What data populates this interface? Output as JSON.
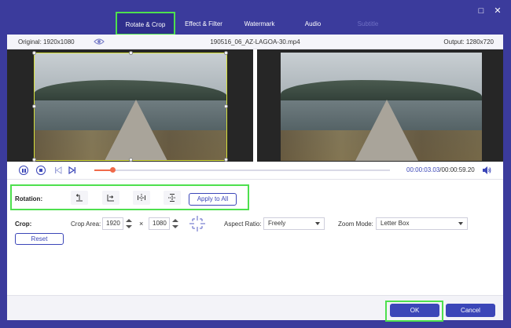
{
  "window": {
    "minimize_icon": "□",
    "close_icon": "✕"
  },
  "tabs": [
    {
      "label": "Rotate & Crop",
      "state": "active"
    },
    {
      "label": "Effect & Filter",
      "state": "normal"
    },
    {
      "label": "Watermark",
      "state": "normal"
    },
    {
      "label": "Audio",
      "state": "normal"
    },
    {
      "label": "Subtitle",
      "state": "disabled"
    }
  ],
  "info": {
    "original": "Original: 1920x1080",
    "filename": "190516_06_AZ-LAGOA-30.mp4",
    "output": "Output: 1280x720"
  },
  "playback": {
    "current_time": "00:00:03.03",
    "total_time": "/00:00:59.20",
    "progress": 0.06
  },
  "rotation": {
    "label": "Rotation:",
    "buttons": [
      "rotate-left-icon",
      "rotate-right-icon",
      "flip-horizontal-icon",
      "flip-vertical-icon"
    ],
    "apply_label": "Apply to All"
  },
  "crop": {
    "label": "Crop:",
    "area_label": "Crop Area:",
    "width": "1920",
    "times": "×",
    "height": "1080",
    "aspect_label": "Aspect Ratio:",
    "aspect_value": "Freely",
    "zoom_label": "Zoom Mode:",
    "zoom_value": "Letter Box",
    "reset_label": "Reset"
  },
  "footer": {
    "ok_label": "OK",
    "cancel_label": "Cancel"
  },
  "colors": {
    "accent": "#3b46b8",
    "highlight": "#4ee04e",
    "progress": "#f06a4a",
    "frame": "#3b3b9c"
  }
}
